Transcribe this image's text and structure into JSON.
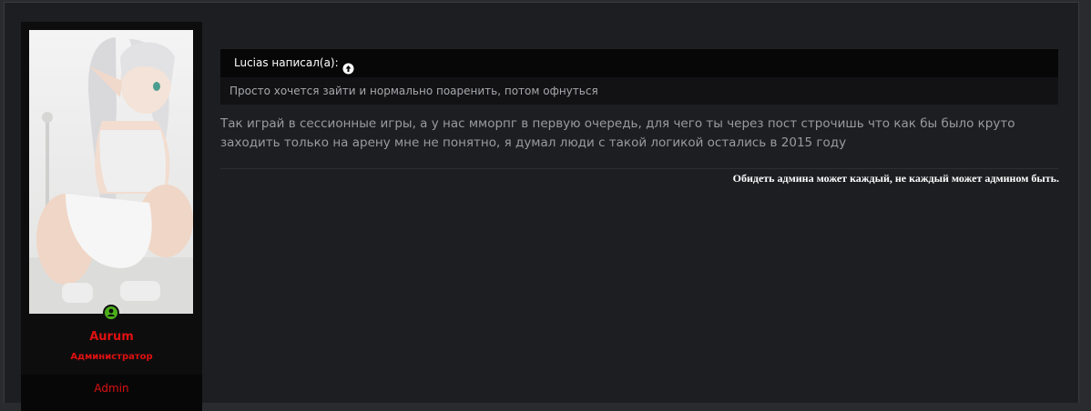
{
  "user": {
    "username": "Aurum",
    "user_title": "Администратор",
    "banner": "Admin",
    "online_status": "online",
    "online_color": "#4caf1a",
    "name_color": "#e01010"
  },
  "quote": {
    "author_label": "Lucias написал(а):",
    "jump_icon": "arrow-circle-up-icon",
    "text": "Просто хочется зайти и нормально поаренить, потом офнуться"
  },
  "message": {
    "text": "Так играй в сессионные игры, а у нас мморпг в первую очередь, для чего ты через пост строчишь что как бы было круто заходить только на арену мне не понятно, я думал люди с такой логикой остались в 2015 году"
  },
  "signature": {
    "text": "Обидеть админа может каждый, не каждый может админом быть."
  }
}
